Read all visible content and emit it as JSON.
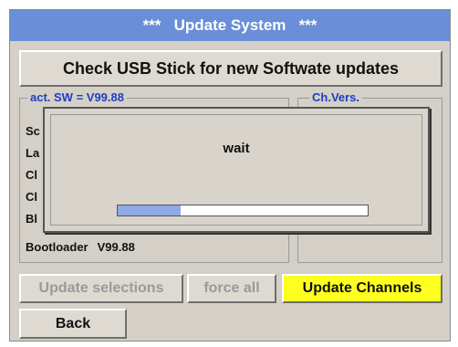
{
  "window": {
    "title": "***   Update System   ***"
  },
  "check_button": {
    "label": "Check USB Stick for new Softwate updates"
  },
  "sw_group": {
    "legend": "act. SW = V99.88",
    "rows": [
      "Sc",
      "La",
      "Cl",
      "Cl",
      "Bl"
    ],
    "bootloader": {
      "label": "Bootloader",
      "value": "V99.88"
    }
  },
  "ch_group": {
    "legend": "Ch.Vers."
  },
  "dialog": {
    "message": "wait",
    "progress": 0.25
  },
  "buttons": {
    "update_selections": "Update selections",
    "force_all": "force all",
    "update_channels": "Update Channels",
    "back": "Back"
  },
  "colors": {
    "title_bar": "#6a8fd8",
    "legend_text": "#1d3fbf",
    "highlight_button": "#ffff1f",
    "progress_fill": "#8fa8e8"
  }
}
